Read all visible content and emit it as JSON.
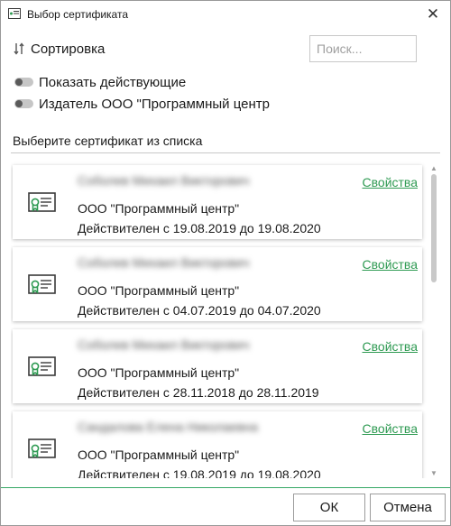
{
  "window": {
    "title": "Выбор сертификата",
    "close_glyph": "✕"
  },
  "toolbar": {
    "sort_label": "Сортировка",
    "search_placeholder": "Поиск...",
    "search_value": ""
  },
  "filters": [
    {
      "label": "Показать действующие",
      "enabled": false
    },
    {
      "label": "Издатель ООО \"Программный центр",
      "enabled": false
    }
  ],
  "list": {
    "heading": "Выберите сертификат из списка",
    "properties_label": "Свойства",
    "certificates": [
      {
        "owner": "Соболев Михаил Викторович",
        "issuer": "ООО \"Программный центр\"",
        "validity": "Действителен с 19.08.2019 до 19.08.2020"
      },
      {
        "owner": "Соболев Михаил Викторович",
        "issuer": "ООО \"Программный центр\"",
        "validity": "Действителен с 04.07.2019 до 04.07.2020"
      },
      {
        "owner": "Соболев Михаил Викторович",
        "issuer": "ООО \"Программный центр\"",
        "validity": "Действителен с 28.11.2018 до 28.11.2019"
      },
      {
        "owner": "Сандалова Елена Николаевна",
        "issuer": "ООО \"Программный центр\"",
        "validity": "Действителен с 19.08.2019 до 19.08.2020"
      }
    ]
  },
  "buttons": {
    "ok_label": "ОК",
    "cancel_label": "Отмена"
  },
  "icons": {
    "title": "certificate-window-icon",
    "sort": "sort-arrows-icon",
    "certificate": "certificate-icon",
    "close": "close-icon"
  },
  "colors": {
    "accent": "#2e9a52",
    "footer_line": "#36a866",
    "toggle_off": "#c6c6c6"
  }
}
